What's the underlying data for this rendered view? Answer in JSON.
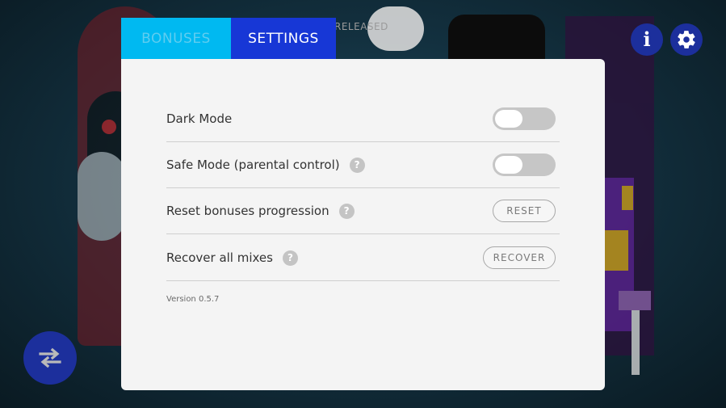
{
  "top_bar": {
    "released_label": "RELEASED",
    "info_glyph": "i",
    "info_icon": "info-icon",
    "settings_icon": "gear-icon"
  },
  "tabs": [
    {
      "label": "BONUSES",
      "active": false
    },
    {
      "label": "SETTINGS",
      "active": true
    }
  ],
  "settings": {
    "rows": [
      {
        "label": "Dark Mode",
        "control": "toggle",
        "value": false,
        "has_help": false
      },
      {
        "label": "Safe Mode (parental control)",
        "control": "toggle",
        "value": false,
        "has_help": true
      },
      {
        "label": "Reset bonuses progression",
        "control": "button",
        "button_label": "RESET",
        "has_help": true
      },
      {
        "label": "Recover all mixes",
        "control": "button",
        "button_label": "RECOVER",
        "has_help": true
      }
    ],
    "help_glyph": "?",
    "version": "Version 0.5.7"
  },
  "swap_button": {
    "icon": "swap-arrows-icon"
  },
  "colors": {
    "accent_dark_blue": "#1737d6",
    "tab_inactive_cyan": "#00b9f1",
    "circle_button_blue": "#1c2f9c",
    "panel_bg": "#f4f4f4"
  }
}
